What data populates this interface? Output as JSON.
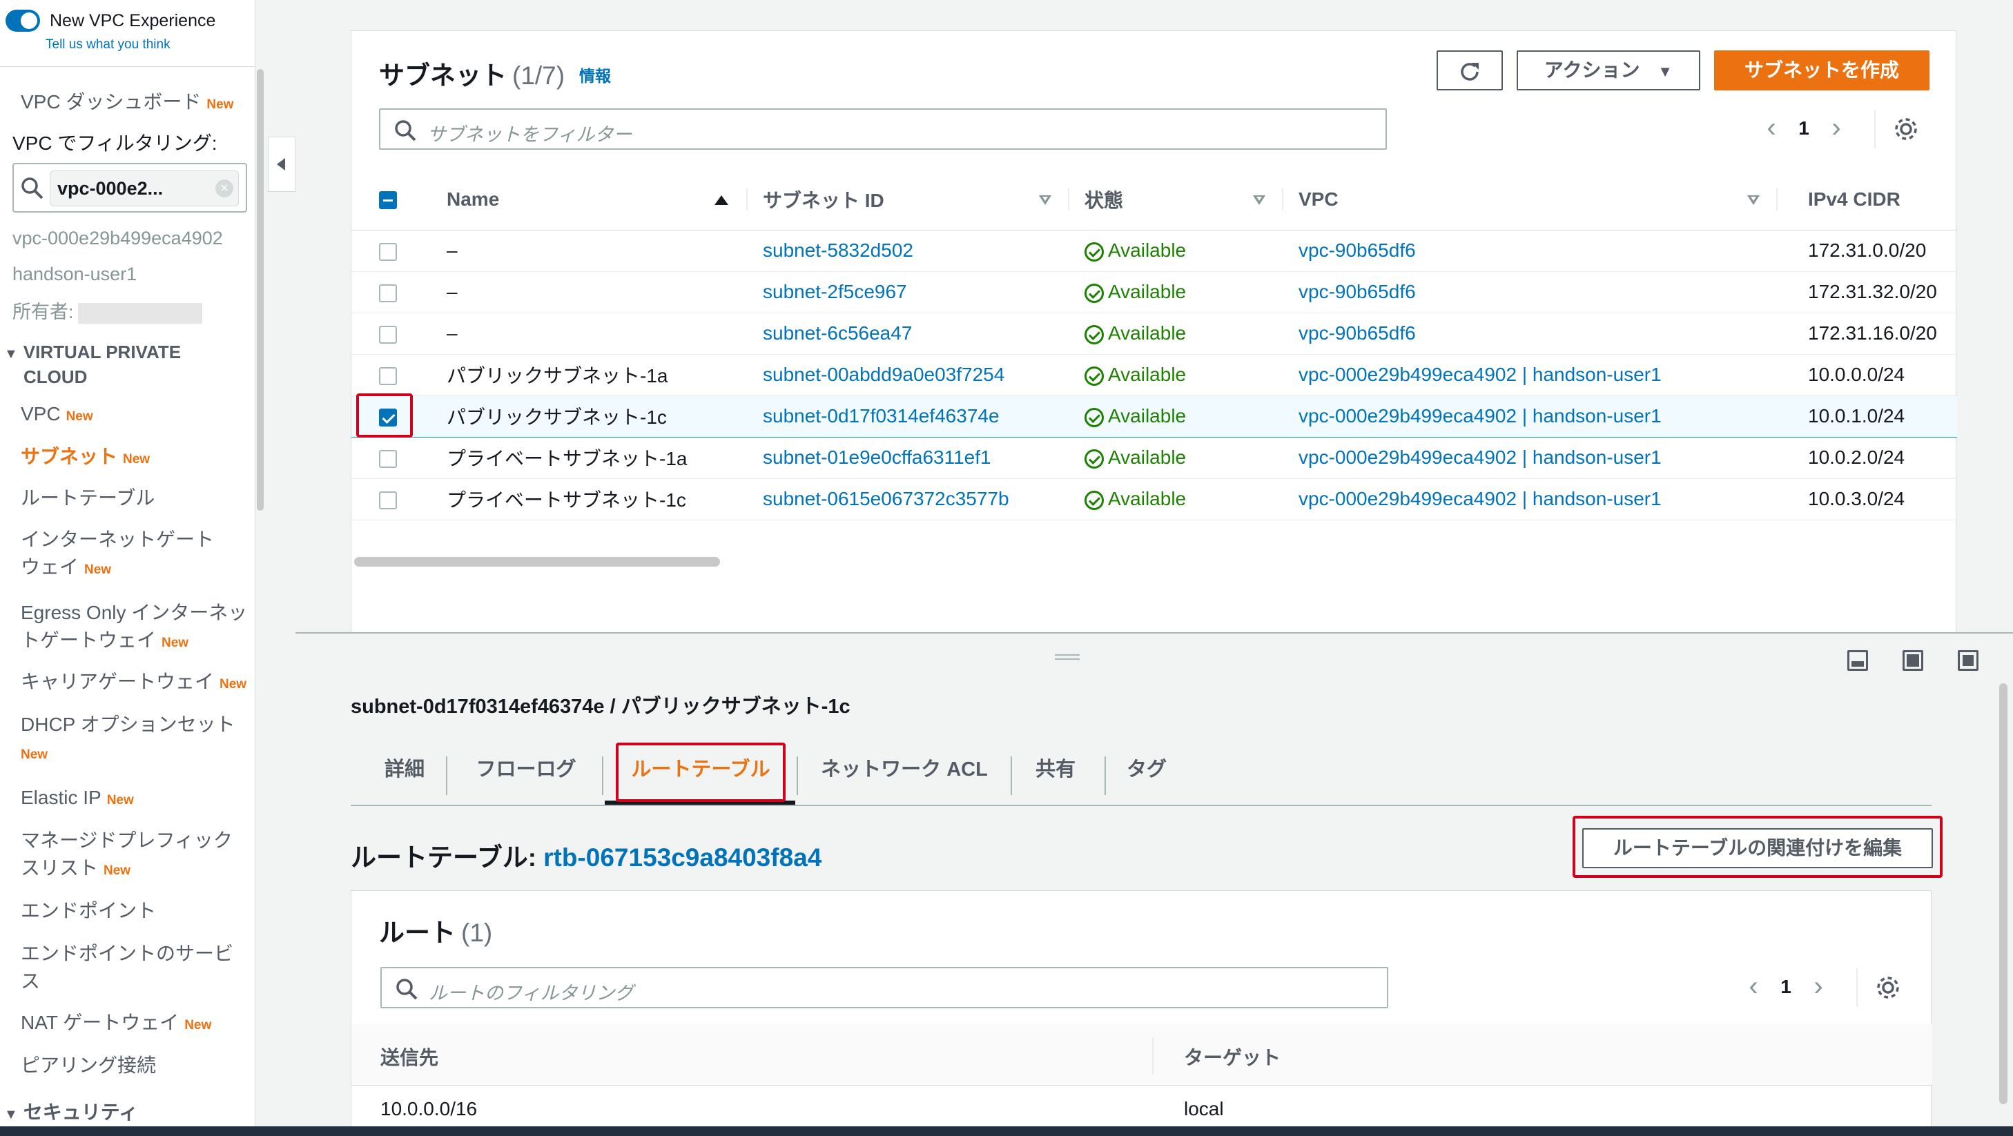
{
  "sidebar": {
    "toggle_label": "New VPC Experience",
    "feedback_link": "Tell us what you think",
    "new_badge": "New",
    "dashboard": "VPC ダッシュボード",
    "filter_label": "VPC でフィルタリング:",
    "filter_value": "vpc-000e2...",
    "vpc_id": "vpc-000e29b499eca4902",
    "vpc_name": "handson-user1",
    "owner_label": "所有者:",
    "section_vpc": "VIRTUAL PRIVATE",
    "section_vpc_2": "CLOUD",
    "items": [
      {
        "label": "VPC"
      },
      {
        "label": "サブネット"
      },
      {
        "label": "ルートテーブル"
      },
      {
        "label": "インターネットゲート",
        "label2": "ウェイ"
      },
      {
        "label": "Egress Only インターネッ",
        "label2": "トゲートウェイ"
      },
      {
        "label": "キャリアゲートウェイ"
      },
      {
        "label": "DHCP オプションセット"
      },
      {
        "label": "Elastic IP"
      },
      {
        "label": "マネージドプレフィック",
        "label2": "スリスト"
      },
      {
        "label": "エンドポイント"
      },
      {
        "label": "エンドポイントのサービ",
        "label2": "ス"
      },
      {
        "label": "NAT ゲートウェイ"
      },
      {
        "label": "ピアリング接続"
      }
    ],
    "section_security": "セキュリティ"
  },
  "subnets_panel": {
    "title": "サブネット",
    "count": "(1/7)",
    "info": "情報",
    "actions_label": "アクション",
    "create_label": "サブネットを作成",
    "filter_placeholder": "サブネットをフィルター",
    "page": "1",
    "columns": [
      "Name",
      "サブネット ID",
      "状態",
      "VPC",
      "IPv4 CIDR"
    ],
    "rows": [
      {
        "name": "–",
        "subnet_id": "subnet-5832d502",
        "state": "Available",
        "vpc": "vpc-90b65df6",
        "cidr": "172.31.0.0/20",
        "checked": false
      },
      {
        "name": "–",
        "subnet_id": "subnet-2f5ce967",
        "state": "Available",
        "vpc": "vpc-90b65df6",
        "cidr": "172.31.32.0/20",
        "checked": false
      },
      {
        "name": "–",
        "subnet_id": "subnet-6c56ea47",
        "state": "Available",
        "vpc": "vpc-90b65df6",
        "cidr": "172.31.16.0/20",
        "checked": false
      },
      {
        "name": "パブリックサブネット-1a",
        "subnet_id": "subnet-00abdd9a0e03f7254",
        "state": "Available",
        "vpc": "vpc-000e29b499eca4902 | handson-user1",
        "cidr": "10.0.0.0/24",
        "checked": false
      },
      {
        "name": "パブリックサブネット-1c",
        "subnet_id": "subnet-0d17f0314ef46374e",
        "state": "Available",
        "vpc": "vpc-000e29b499eca4902 | handson-user1",
        "cidr": "10.0.1.0/24",
        "checked": true
      },
      {
        "name": "プライベートサブネット-1a",
        "subnet_id": "subnet-01e9e0cffa6311ef1",
        "state": "Available",
        "vpc": "vpc-000e29b499eca4902 | handson-user1",
        "cidr": "10.0.2.0/24",
        "checked": false
      },
      {
        "name": "プライベートサブネット-1c",
        "subnet_id": "subnet-0615e067372c3577b",
        "state": "Available",
        "vpc": "vpc-000e29b499eca4902 | handson-user1",
        "cidr": "10.0.3.0/24",
        "checked": false
      }
    ]
  },
  "detail": {
    "title": "subnet-0d17f0314ef46374e / パブリックサブネット-1c",
    "tabs": [
      "詳細",
      "フローログ",
      "ルートテーブル",
      "ネットワーク ACL",
      "共有",
      "タグ"
    ],
    "active_tab": "ルートテーブル",
    "route_table_label": "ルートテーブル:",
    "route_table_id": "rtb-067153c9a8403f8a4",
    "edit_assoc_label": "ルートテーブルの関連付けを編集",
    "routes_title": "ルート",
    "routes_count": "(1)",
    "routes_filter_placeholder": "ルートのフィルタリング",
    "routes_page": "1",
    "routes_columns": [
      "送信先",
      "ターゲット"
    ],
    "routes_rows": [
      {
        "destination": "10.0.0.0/16",
        "target": "local"
      }
    ]
  },
  "colors": {
    "accent": "#ec7211",
    "link": "#0073bb",
    "success": "#1d8102",
    "highlight": "#d0021b"
  }
}
